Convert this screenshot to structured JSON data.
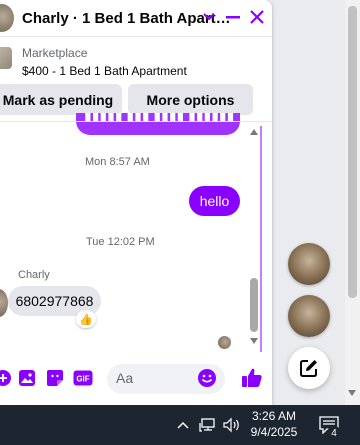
{
  "chat": {
    "title": "Charly · 1 Bed 1 Bath Apart…",
    "listing": {
      "label": "Marketplace",
      "title": "$400 - 1 Bed 1 Bath Apartment"
    },
    "actions": {
      "pending_label": "Mark as pending",
      "more_label": "More options"
    },
    "messages": [
      {
        "timestamp": "Mon 8:57 AM",
        "from": "me",
        "text": "hello"
      },
      {
        "timestamp": "Tue 12:02 PM",
        "from": "Charly",
        "sender_label": "Charly",
        "text": "6802977868",
        "reaction": "👍"
      }
    ],
    "composer": {
      "placeholder": "Aa"
    },
    "accent_color": "#8a00ff"
  },
  "taskbar": {
    "time": "3:26 AM",
    "date": "9/4/2025",
    "notification_count": "4"
  }
}
